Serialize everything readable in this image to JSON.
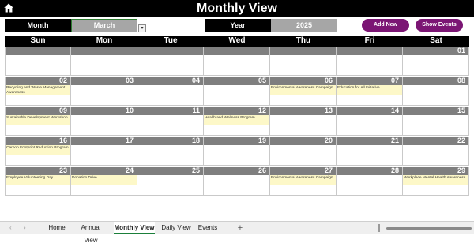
{
  "title": "Monthly View",
  "controls": {
    "month_label": "Month",
    "month_value": "March",
    "dropdown_glyph": "▾",
    "year_label": "Year",
    "year_value": "2025",
    "add_new": "Add New",
    "show_events": "Show Events"
  },
  "weekdays": [
    "Sun",
    "Mon",
    "Tue",
    "Wed",
    "Thu",
    "Fri",
    "Sat"
  ],
  "weeks": [
    [
      {
        "day": ""
      },
      {
        "day": ""
      },
      {
        "day": ""
      },
      {
        "day": ""
      },
      {
        "day": ""
      },
      {
        "day": ""
      },
      {
        "day": "01"
      }
    ],
    [
      {
        "day": "02",
        "event": "Recycling and Waste Management Awareness"
      },
      {
        "day": "03"
      },
      {
        "day": "04"
      },
      {
        "day": "05"
      },
      {
        "day": "06",
        "event": "Environmental Awareness Campaign"
      },
      {
        "day": "07",
        "event": "Education for All Initiative"
      },
      {
        "day": "08"
      }
    ],
    [
      {
        "day": "09",
        "event": "Sustainable Development Workshop"
      },
      {
        "day": "10"
      },
      {
        "day": "11"
      },
      {
        "day": "12",
        "event": "Health and Wellness Program"
      },
      {
        "day": "13"
      },
      {
        "day": "14"
      },
      {
        "day": "15"
      }
    ],
    [
      {
        "day": "16",
        "event": "Carbon Footprint Reduction Program"
      },
      {
        "day": "17"
      },
      {
        "day": "18"
      },
      {
        "day": "19"
      },
      {
        "day": "20"
      },
      {
        "day": "21"
      },
      {
        "day": "22"
      }
    ],
    [
      {
        "day": "23",
        "event": "Employee Volunteering Day"
      },
      {
        "day": "24",
        "event": "Donation Drive"
      },
      {
        "day": "25"
      },
      {
        "day": "26"
      },
      {
        "day": "27",
        "event": "Environmental Awareness Campaign"
      },
      {
        "day": "28"
      },
      {
        "day": "29",
        "event": "Workplace Mental Health Awareness"
      }
    ]
  ],
  "sheet_tabs": [
    "Home",
    "Annual View",
    "Monthly View",
    "Daily View",
    "Events"
  ],
  "active_tab": "Monthly View",
  "nav": {
    "prev": "‹",
    "next": "›",
    "add": "+"
  },
  "colors": {
    "header_black": "#000000",
    "accent_purple": "#7b1574",
    "day_bar_gray": "#7f7f7f",
    "event_yellow": "#fdf8c8",
    "active_tab_green": "#1b7f3a"
  }
}
